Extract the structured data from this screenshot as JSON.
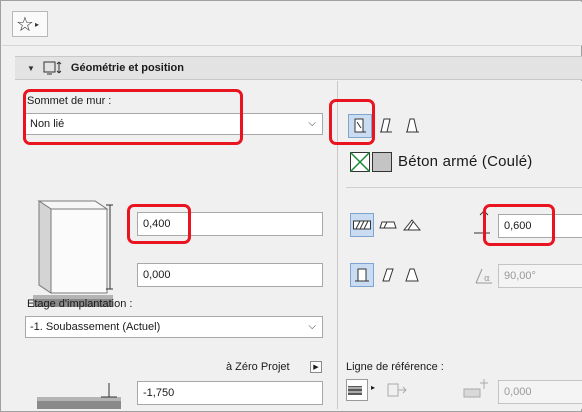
{
  "toolbar": {
    "favorites_icon": "star-icon"
  },
  "section": {
    "title": "Géométrie et position",
    "icon": "wall-geometry-icon"
  },
  "left": {
    "top_label": "Sommet de mur :",
    "top_value": "Non lié",
    "height_value": "0,400",
    "base_offset_value": "0,000",
    "story_label": "Etage d'implantation :",
    "story_value": "-1. Soubassement (Actuel)",
    "zero_label": "à Zéro Projet",
    "elevation_value": "-1,750"
  },
  "right": {
    "material_name": "Béton armé (Coulé)",
    "thickness_value": "0,600",
    "angle_value": "90,00°",
    "ref_line_label": "Ligne de référence :",
    "ref_offset_value": "0,000"
  },
  "colors": {
    "highlight": "#e8141f",
    "selected": "#c9dcf2"
  }
}
